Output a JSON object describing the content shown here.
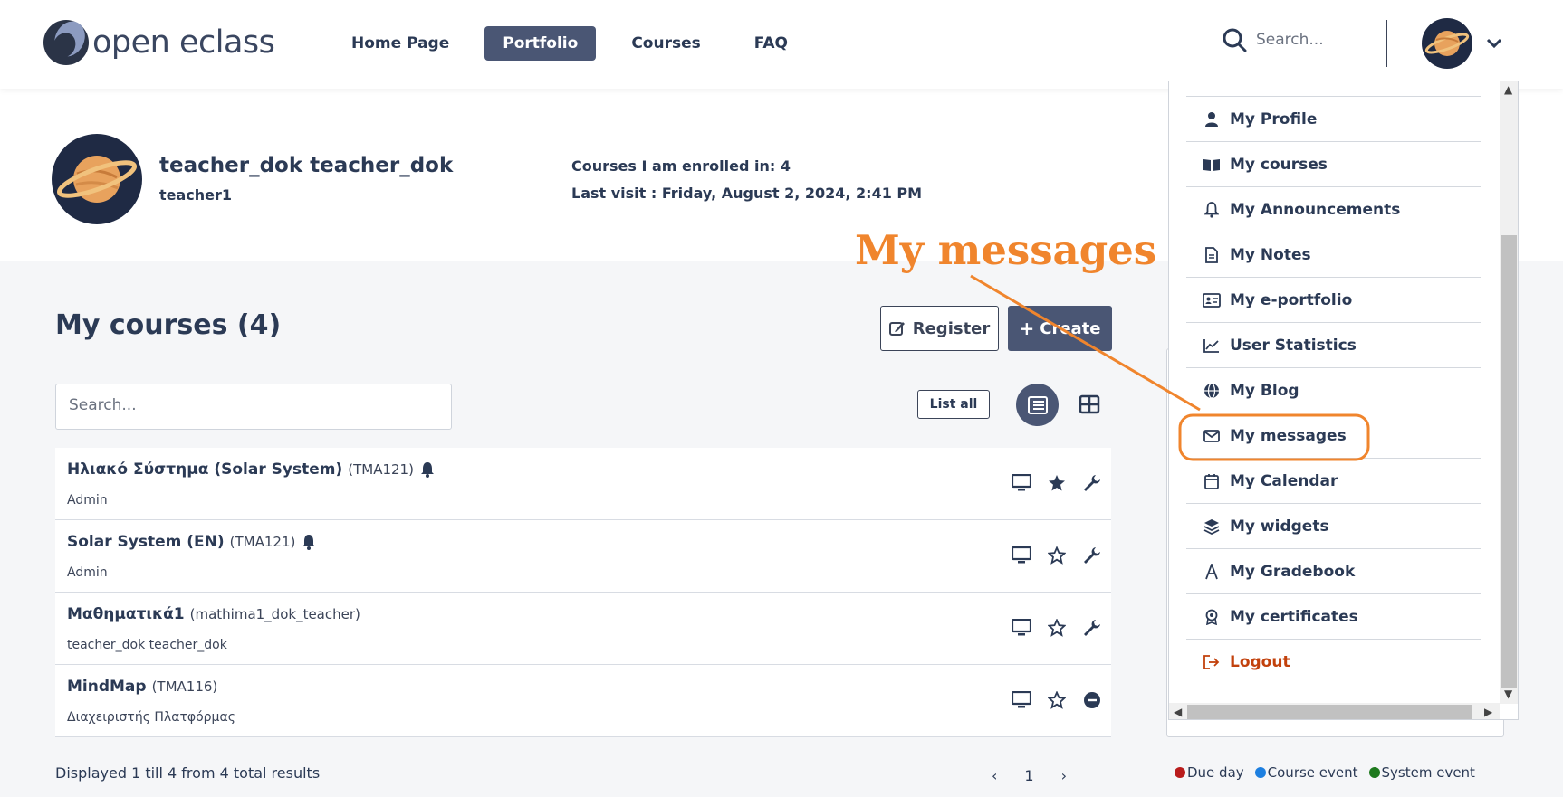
{
  "header": {
    "logo_text": "open eclass",
    "nav": [
      {
        "label": "Home Page"
      },
      {
        "label": "Portfolio"
      },
      {
        "label": "Courses"
      },
      {
        "label": "FAQ"
      }
    ],
    "search_placeholder": "Search..."
  },
  "profile": {
    "name": "teacher_dok teacher_dok",
    "username": "teacher1",
    "enrolled": "Courses I am enrolled in: 4",
    "last_visit": "Last visit : Friday, August 2, 2024, 2:41 PM"
  },
  "main": {
    "title": "My courses  (4)",
    "register_label": "Register",
    "create_label": "Create",
    "search_placeholder": "Search...",
    "list_all_label": "List all",
    "courses": [
      {
        "title": "Ηλιακό Σύστημα (Solar System)",
        "code": "(TMA121)",
        "owner": "Admin",
        "bell": true,
        "star": "filled",
        "tool": "wrench"
      },
      {
        "title": "Solar System (EN)",
        "code": "(TMA121)",
        "owner": "Admin",
        "bell": true,
        "star": "outline",
        "tool": "wrench"
      },
      {
        "title": "Μαθηματικά1",
        "code": "(mathima1_dok_teacher)",
        "owner": "teacher_dok teacher_dok",
        "bell": false,
        "star": "outline",
        "tool": "wrench"
      },
      {
        "title": "MindMap",
        "code": "(TMA116)",
        "owner": "Διαχειριστής Πλατφόρμας",
        "bell": false,
        "star": "outline",
        "tool": "minus-circle"
      }
    ],
    "displayed": "Displayed 1 till 4 from 4 total results",
    "pager": {
      "prev": "‹",
      "page": "1",
      "next": "›"
    }
  },
  "legend": [
    {
      "label": "Due day",
      "color": "#b91c1c"
    },
    {
      "label": "Course event",
      "color": "#1d7fe0"
    },
    {
      "label": "System event",
      "color": "#1e7a1e"
    }
  ],
  "dropdown": {
    "items": [
      {
        "label": "My Profile",
        "icon": "user-icon"
      },
      {
        "label": "My courses",
        "icon": "book-icon"
      },
      {
        "label": "My Announcements",
        "icon": "bell-icon"
      },
      {
        "label": "My Notes",
        "icon": "note-icon"
      },
      {
        "label": "My e-portfolio",
        "icon": "id-card-icon"
      },
      {
        "label": "User Statistics",
        "icon": "chart-icon"
      },
      {
        "label": "My Blog",
        "icon": "globe-icon"
      },
      {
        "label": "My messages",
        "icon": "envelope-icon"
      },
      {
        "label": "My Calendar",
        "icon": "calendar-icon"
      },
      {
        "label": "My widgets",
        "icon": "layers-icon"
      },
      {
        "label": "My Gradebook",
        "icon": "gradebook-icon"
      },
      {
        "label": "My certificates",
        "icon": "award-icon"
      },
      {
        "label": "Logout",
        "icon": "logout-icon"
      }
    ]
  },
  "annotation": {
    "label": "My messages",
    "color": "#f0852d"
  }
}
